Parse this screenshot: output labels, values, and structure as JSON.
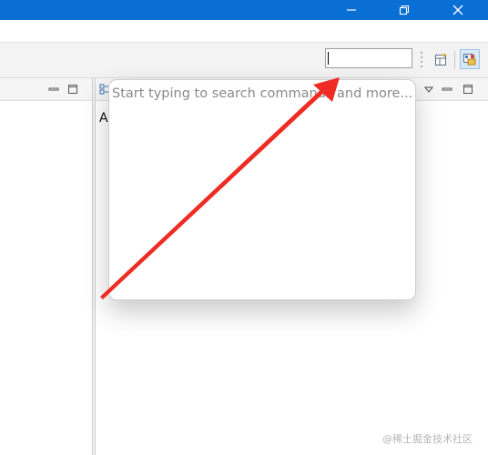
{
  "title_bar": {
    "accent_color": "#0a6fd4",
    "buttons": [
      {
        "name": "minimize",
        "glyph": "—"
      },
      {
        "name": "restore",
        "glyph": "❐"
      },
      {
        "name": "close",
        "glyph": "✕"
      }
    ]
  },
  "toolbar": {
    "quick_access_value": "",
    "buttons": [
      {
        "name": "open-perspective",
        "icon": "open-perspective-icon"
      },
      {
        "name": "perspective",
        "icon": "perspective-icon",
        "active": true
      }
    ]
  },
  "right_view": {
    "label_partial": "A"
  },
  "quick_access_popup": {
    "placeholder": "Start typing to search commands and more..."
  },
  "annotation": {
    "color": "#ee2c24",
    "icon": "red-arrow-annotation"
  },
  "watermark": {
    "text": "@稀土掘金技术社区"
  }
}
